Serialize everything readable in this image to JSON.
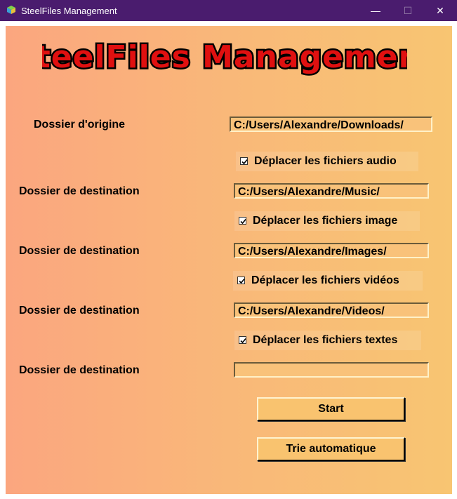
{
  "window": {
    "title": "SteelFiles Management",
    "controls": {
      "minimize": "—",
      "maximize": "☐",
      "close": "✕"
    },
    "icon": "app-cube-icon"
  },
  "header": {
    "logo_text": "SteelFiles Management"
  },
  "form": {
    "origin_label": "Dossier d'origine",
    "origin_path": "C:/Users/Alexandre/Downloads/",
    "sections": [
      {
        "checkbox_label": "Déplacer les fichiers audio",
        "checked": true,
        "dest_label": "Dossier de destination",
        "dest_path": "C:/Users/Alexandre/Music/"
      },
      {
        "checkbox_label": "Déplacer les fichiers image",
        "checked": true,
        "dest_label": "Dossier de destination",
        "dest_path": "C:/Users/Alexandre/Images/"
      },
      {
        "checkbox_label": "Déplacer les fichiers vidéos",
        "checked": true,
        "dest_label": "Dossier de destination",
        "dest_path": "C:/Users/Alexandre/Videos/"
      },
      {
        "checkbox_label": "Déplacer les fichiers textes",
        "checked": true,
        "dest_label": "Dossier de destination",
        "dest_path": ""
      }
    ]
  },
  "actions": {
    "start_label": "Start",
    "auto_sort_label": "Trie automatique"
  },
  "colors": {
    "titlebar": "#4a1c6e",
    "gradient_left": "#fba67f",
    "gradient_right": "#f8c572",
    "logo_fill": "#e01010",
    "logo_outline": "#000000"
  }
}
